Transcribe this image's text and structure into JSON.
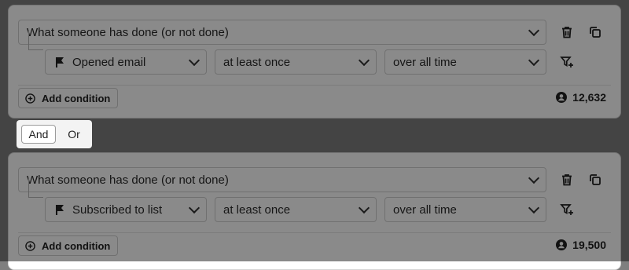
{
  "groups": [
    {
      "condition_type": "What someone has done (or not done)",
      "event": "Opened email",
      "frequency": "at least once",
      "timeframe": "over all time",
      "add_condition_label": "Add condition",
      "count": "12,632"
    },
    {
      "condition_type": "What someone has done (or not done)",
      "event": "Subscribed to list",
      "frequency": "at least once",
      "timeframe": "over all time",
      "add_condition_label": "Add condition",
      "count": "19,500"
    }
  ],
  "logic_toggle": {
    "and_label": "And",
    "or_label": "Or",
    "selected": "And"
  },
  "icons": [
    "flag-icon",
    "chevron-down-icon",
    "trash-icon",
    "copy-icon",
    "filter-add-icon",
    "plus-circle-icon",
    "person-icon"
  ],
  "colors": {
    "overlay": "#000000",
    "card_border": "#d6d6d6",
    "text": "#2a2a2a"
  }
}
